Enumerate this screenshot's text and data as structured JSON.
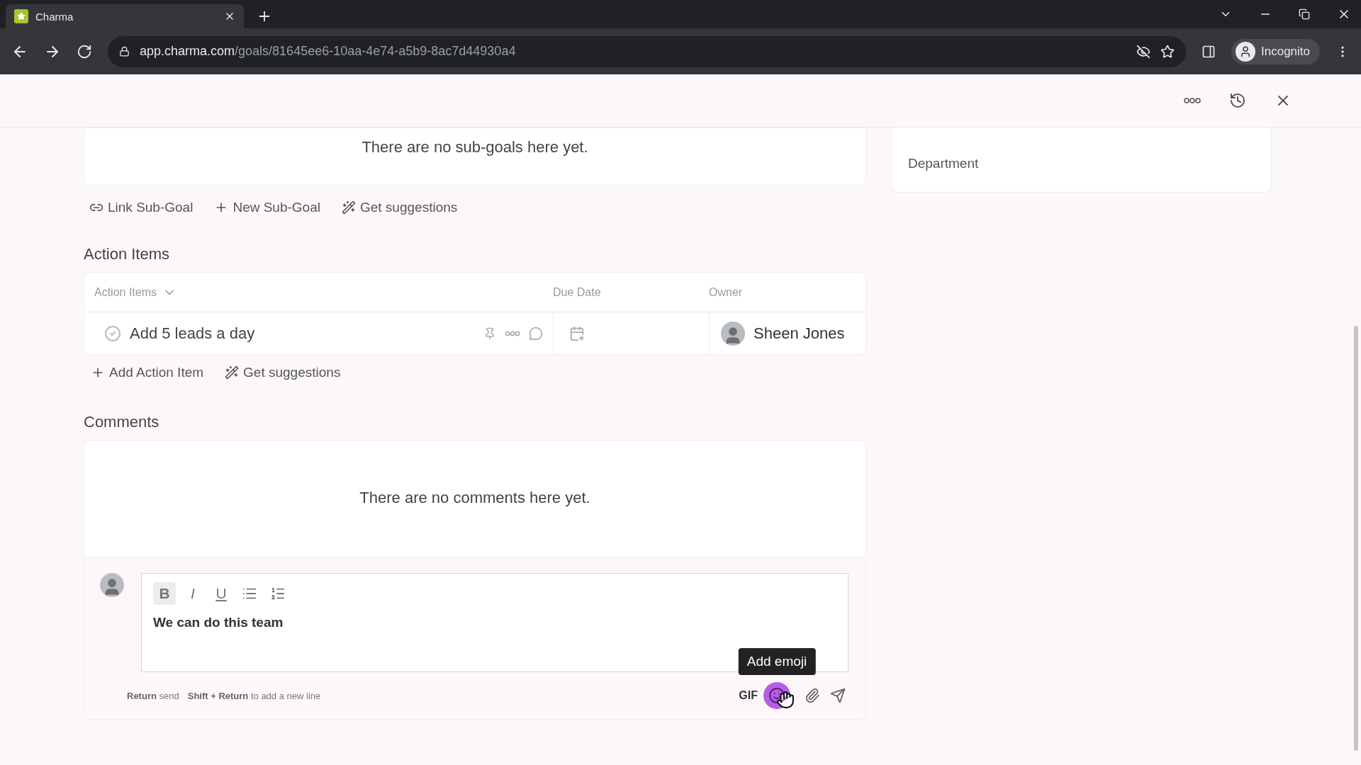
{
  "browser": {
    "tab_title": "Charma",
    "url_domain": "app.charma.com",
    "url_path": "/goals/81645ee6-10aa-4e74-a5b9-8ac7d44930a4",
    "profile": "Incognito"
  },
  "subgoals": {
    "empty_text": "There are no sub-goals here yet.",
    "actions": [
      {
        "kind": "link",
        "label": "Link Sub-Goal"
      },
      {
        "kind": "add",
        "label": "New Sub-Goal"
      },
      {
        "kind": "magic",
        "label": "Get suggestions"
      }
    ]
  },
  "action_items": {
    "heading": "Action Items",
    "columns": [
      "Action Items",
      "Due Date",
      "Owner"
    ],
    "rows": [
      {
        "title": "Add 5 leads a day",
        "done": false,
        "owner": "Sheen Jones"
      }
    ],
    "actions": [
      {
        "kind": "add",
        "label": "Add Action Item"
      },
      {
        "kind": "magic",
        "label": "Get suggestions"
      }
    ]
  },
  "comments": {
    "heading": "Comments",
    "empty_text": "There are no comments here yet.",
    "toolbar": [
      {
        "kind": "bold",
        "label": "B",
        "selected": true
      },
      {
        "kind": "italic",
        "label": "I",
        "selected": false
      },
      {
        "kind": "underline",
        "label": "U",
        "selected": false
      },
      {
        "kind": "bullet-list",
        "selected": false
      },
      {
        "kind": "numbered-list",
        "selected": false
      }
    ],
    "value": "We can do this team",
    "hints": [
      {
        "key": "Return",
        "text": "send"
      },
      {
        "key": "Shift + Return",
        "text": "to add a new line"
      }
    ],
    "gif": "GIF",
    "tooltip": "Add emoji",
    "emoji_hovered": true
  },
  "side_panel": {
    "fields": [
      "Department"
    ]
  }
}
